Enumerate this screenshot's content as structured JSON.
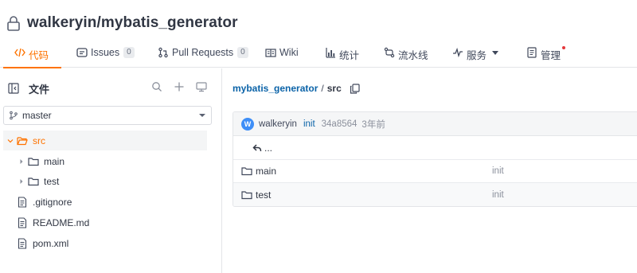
{
  "repo": {
    "name": "walkeryin/mybatis_generator"
  },
  "tabs": [
    {
      "label": "代码",
      "icon": "code-icon",
      "active": true
    },
    {
      "label": "Issues",
      "icon": "issues-icon",
      "count": "0"
    },
    {
      "label": "Pull Requests",
      "icon": "pull-request-icon",
      "count": "0"
    },
    {
      "label": "Wiki",
      "icon": "wiki-icon"
    },
    {
      "label": "统计",
      "icon": "stats-icon"
    },
    {
      "label": "流水线",
      "icon": "pipeline-icon"
    },
    {
      "label": "服务",
      "icon": "pulse-icon"
    },
    {
      "label": "管理",
      "icon": "manage-icon"
    }
  ],
  "sidebar": {
    "title": "文件",
    "branch": "master",
    "tree": [
      {
        "label": "src",
        "type": "folder-open",
        "selected": true
      },
      {
        "label": "main",
        "type": "folder"
      },
      {
        "label": "test",
        "type": "folder"
      },
      {
        "label": ".gitignore",
        "type": "file"
      },
      {
        "label": "README.md",
        "type": "file"
      },
      {
        "label": "pom.xml",
        "type": "file"
      }
    ]
  },
  "breadcrumb": {
    "root": "mybatis_generator",
    "separator": "/",
    "current": "src"
  },
  "commit": {
    "avatar_letter": "W",
    "user": "walkeryin",
    "message": "init",
    "hash": "34a8564",
    "time": "3年前"
  },
  "listing": {
    "up_label": "...",
    "rows": [
      {
        "name": "main",
        "message": "init"
      },
      {
        "name": "test",
        "message": "init"
      }
    ]
  },
  "colors": {
    "accent": "#fe7300",
    "link": "#0b63a8",
    "avatar": "#3e8ef7"
  }
}
